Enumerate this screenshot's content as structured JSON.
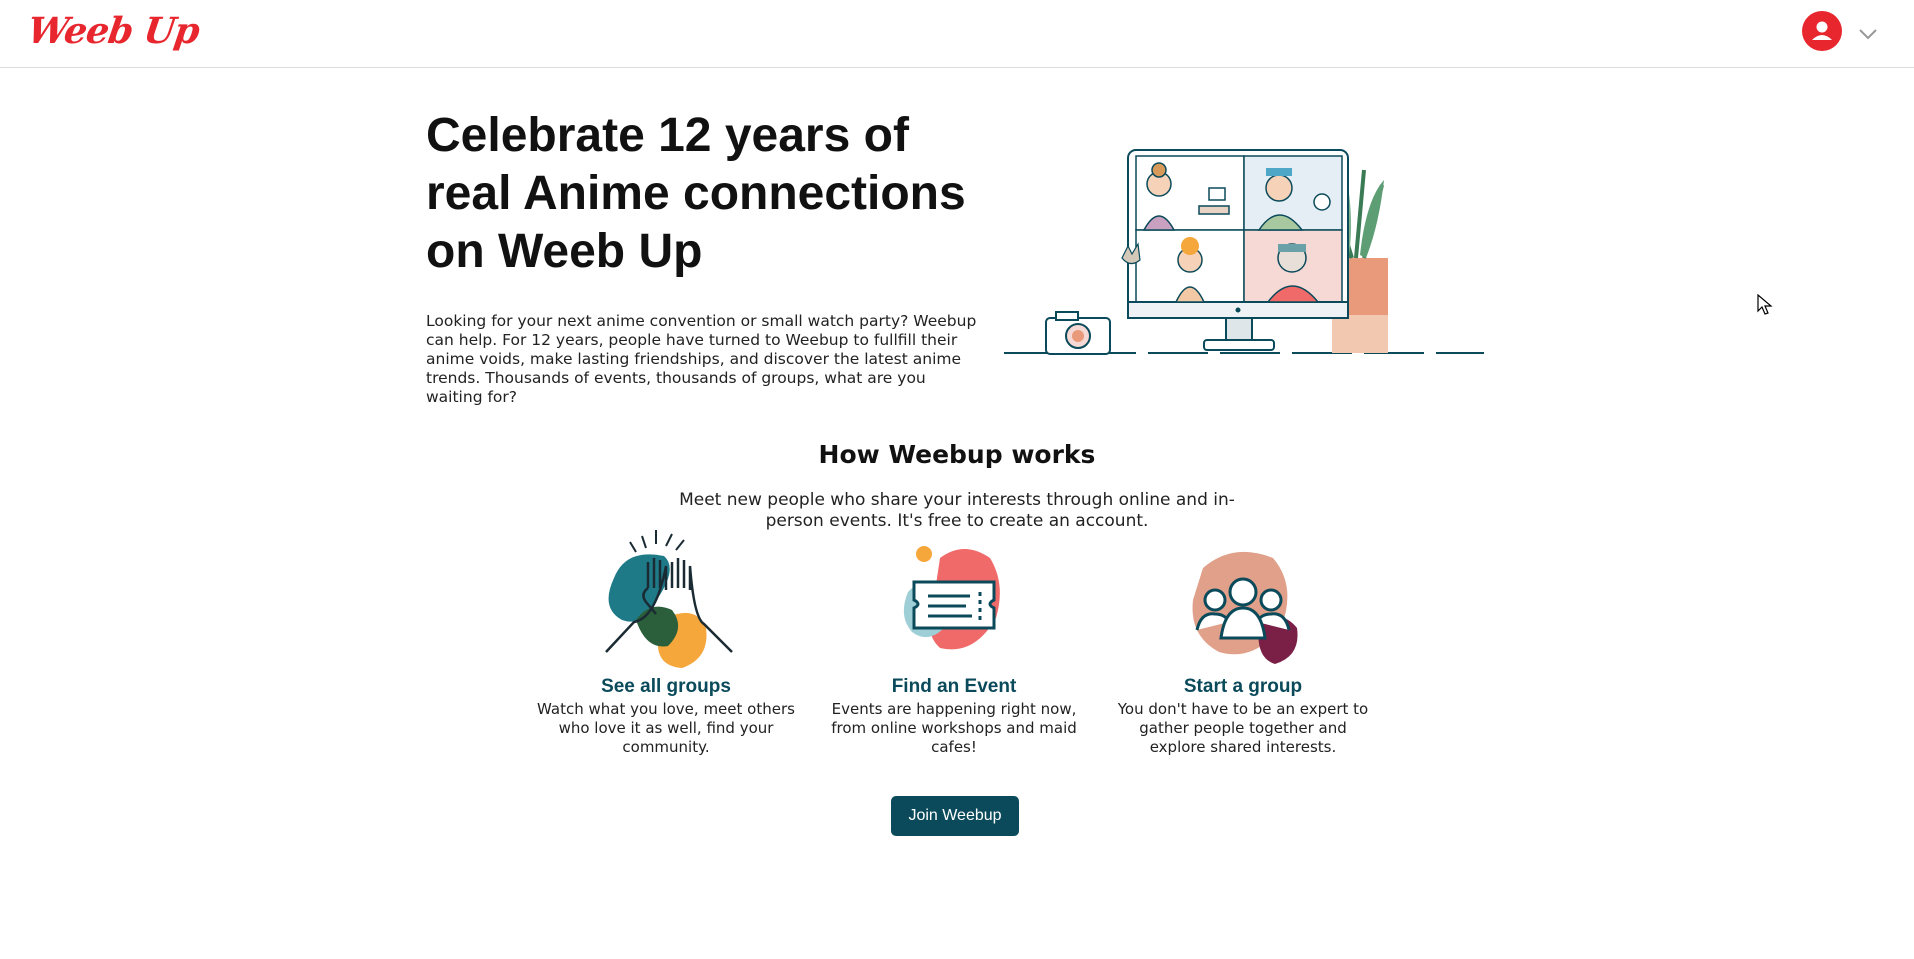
{
  "header": {
    "logo_text": "Weeb Up",
    "brand_color": "#e8262d",
    "avatar_icon": "user-icon",
    "menu_icon": "chevron-down-icon"
  },
  "hero": {
    "title": "Celebrate 12 years of real Anime connections on Weeb Up",
    "body": "Looking for your next anime convention or small watch party? Weebup can help. For 12 years, people have turned to Weebup to fullfill their anime voids, make lasting friendships, and discover the latest anime trends. Thousands of events, thousands of groups, what are you waiting for?",
    "illustration": "video-call-illustration"
  },
  "how": {
    "title": "How Weebup works",
    "subtitle": "Meet new people who share your interests through online and in-person events. It's free to create an account.",
    "cards": [
      {
        "icon": "high-five-icon",
        "title": "See all groups",
        "desc": "Watch what you love, meet others who love it as well, find your community."
      },
      {
        "icon": "ticket-icon",
        "title": "Find an Event",
        "desc": "Events are happening right now, from online workshops and maid cafes!"
      },
      {
        "icon": "people-group-icon",
        "title": "Start a group",
        "desc": "You don't have to be an expert to gather people together and explore shared interests."
      }
    ],
    "join_label": "Join Weebup"
  },
  "colors": {
    "accent": "#0b4a5a",
    "teal": "#1f7a88",
    "orange": "#f5a73b",
    "coral": "#f06a6a",
    "peach": "#e0a08a",
    "plum": "#7a1f45"
  }
}
